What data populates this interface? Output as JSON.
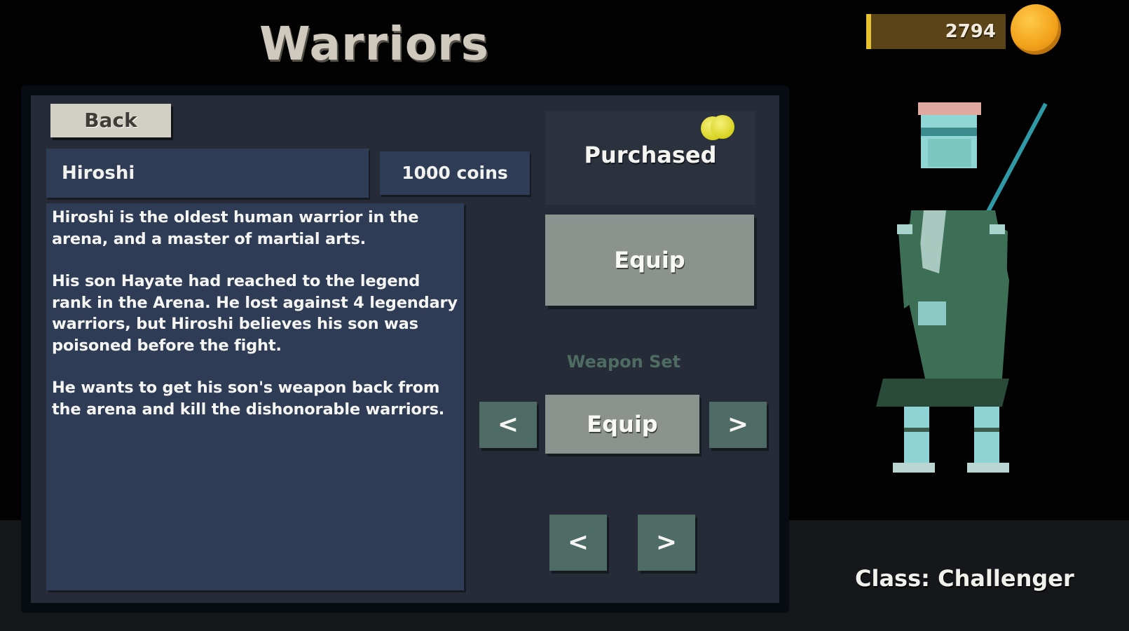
{
  "header": {
    "title": "Warriors"
  },
  "currency": {
    "amount": "2794",
    "icon": "gold-coin-icon"
  },
  "navigation": {
    "back_label": "Back"
  },
  "warrior": {
    "name": "Hiroshi",
    "price": "1000 coins",
    "description": [
      "Hiroshi is the oldest human warrior in the arena, and a master of martial arts.",
      "His son Hayate had reached to the legend rank in the Arena. He lost against 4 legendary warriors, but Hiroshi believes his son was poisoned before the fight.",
      "He wants to get his son's weapon back from the arena and kill the dishonorable warriors."
    ],
    "status": "Purchased",
    "equip_label": "Equip",
    "class_label": "Class: Challenger"
  },
  "weapon_set": {
    "label": "Weapon Set",
    "equip_label": "Equip",
    "prev_label": "<",
    "next_label": ">"
  },
  "warrior_nav": {
    "prev_label": "<",
    "next_label": ">"
  },
  "colors": {
    "panel": "#252b37",
    "box": "#2f3c56",
    "button_gray": "#8c928e",
    "arrow_green": "#4f6b66",
    "coin_gold": "#f2a21b"
  }
}
